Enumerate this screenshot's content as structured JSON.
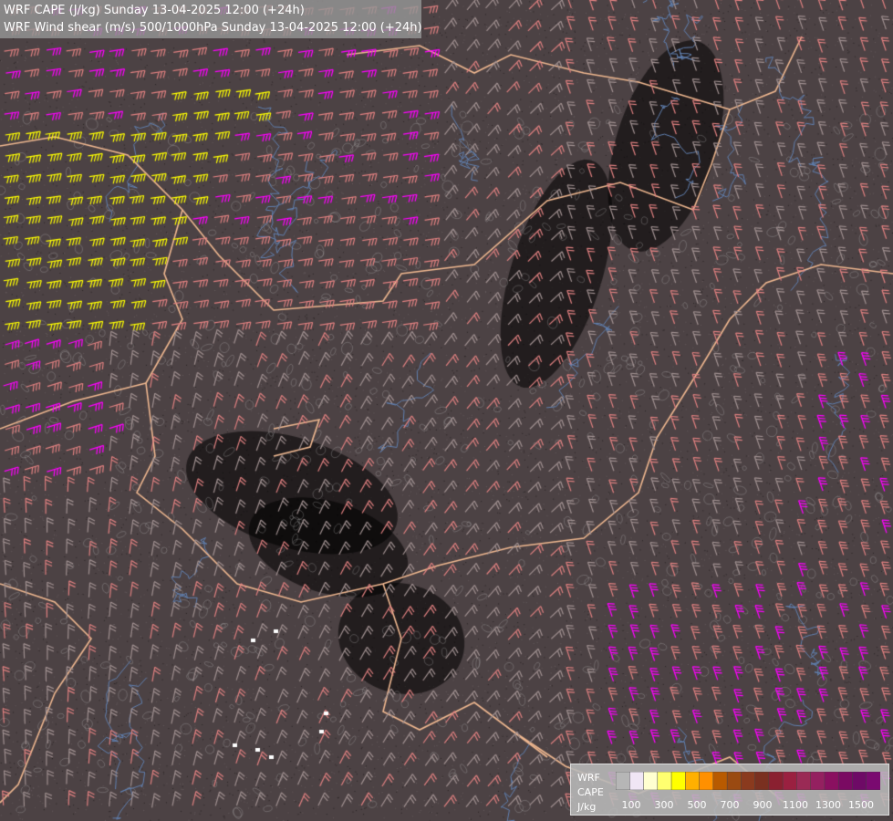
{
  "header": {
    "line1": "WRF CAPE (J/kg) Sunday 13-04-2025 12:00 (+24h)",
    "line2": "WRF Wind shear (m/s) 500/1000hPa Sunday 13-04-2025 12:00 (+24h)"
  },
  "legend": {
    "title_line1": "WRF",
    "title_line2": "CAPE",
    "unit": "J/kg",
    "colors": [
      "#b6b6b6",
      "#f0e6f5",
      "#ffffd0",
      "#ffff70",
      "#ffff00",
      "#ffb000",
      "#ff9000",
      "#b85a00",
      "#9a4a12",
      "#8a3a1e",
      "#7a3020",
      "#8a2030",
      "#9a2040",
      "#9a2a55",
      "#942060",
      "#8a1060",
      "#7a0a62",
      "#6e0a66",
      "#7a0a70"
    ],
    "ticks": [
      "100",
      "300",
      "500",
      "700",
      "900",
      "1100",
      "1300",
      "1500"
    ]
  },
  "map": {
    "background": "#4c4244",
    "barb_colors": {
      "low": "#a09090",
      "moderate": "#e08080",
      "strong": "#ff00ff",
      "extreme": "#ffff00"
    },
    "border_color": "#f0b890",
    "river_color": "#6080b0"
  }
}
